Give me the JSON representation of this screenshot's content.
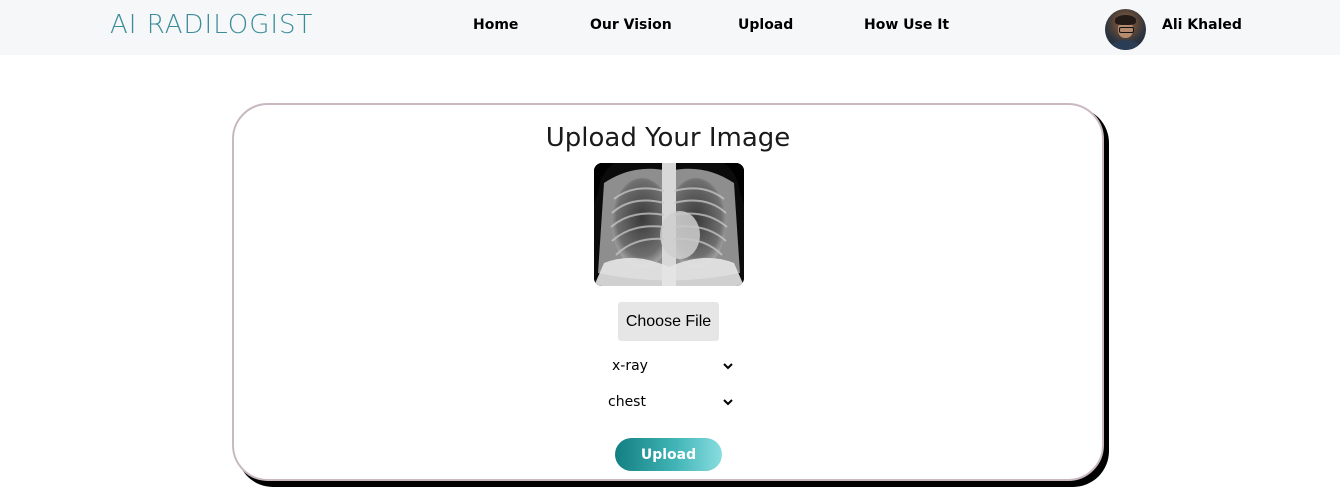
{
  "navbar": {
    "logo_text": "AI RADILOGIST",
    "links": [
      {
        "label": "Home"
      },
      {
        "label": "Our Vision"
      },
      {
        "label": "Upload"
      },
      {
        "label": "How Use It"
      }
    ],
    "user_name": "Ali Khaled",
    "brand_color": "#3a8c98"
  },
  "upload_card": {
    "title": "Upload Your Image",
    "preview_image": "chest-xray",
    "choose_file_label": "Choose File",
    "modality_select": {
      "selected": "x-ray"
    },
    "region_select": {
      "selected": "chest"
    },
    "upload_label": "Upload",
    "upload_gradient": [
      "#137f82",
      "#88dde0"
    ]
  }
}
